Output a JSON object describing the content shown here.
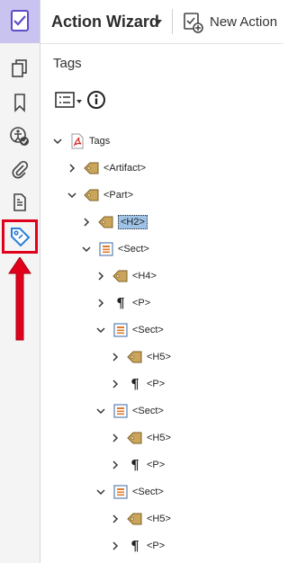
{
  "header": {
    "title": "Action Wizard",
    "new_action": "New Action"
  },
  "panel": {
    "title": "Tags"
  },
  "toolbar": {
    "items": [
      "tools-icon",
      "pages-icon",
      "bookmarks-icon",
      "accessibility-icon",
      "attachments-icon",
      "content-icon",
      "tags-icon"
    ],
    "active": "tags-icon"
  },
  "annotation": {
    "arrow_color": "#e0001b",
    "highlight_color": "#e0001b"
  },
  "tree": [
    {
      "label": "Tags",
      "level": 0,
      "icon": "pdf-icon",
      "expanded": true
    },
    {
      "label": "<Artifact>",
      "level": 1,
      "icon": "tag-icon",
      "expanded": false
    },
    {
      "label": "<Part>",
      "level": 1,
      "icon": "tag-icon",
      "expanded": true
    },
    {
      "label": "<H2>",
      "level": 2,
      "icon": "tag-icon",
      "expanded": false,
      "selected": true
    },
    {
      "label": "<Sect>",
      "level": 2,
      "icon": "sect-icon",
      "expanded": true
    },
    {
      "label": "<H4>",
      "level": 3,
      "icon": "tag-icon",
      "expanded": false
    },
    {
      "label": "<P>",
      "level": 3,
      "icon": "paragraph-icon",
      "expanded": false
    },
    {
      "label": "<Sect>",
      "level": 3,
      "icon": "sect-icon",
      "expanded": true
    },
    {
      "label": "<H5>",
      "level": 4,
      "icon": "tag-icon",
      "expanded": false
    },
    {
      "label": "<P>",
      "level": 4,
      "icon": "paragraph-icon",
      "expanded": false
    },
    {
      "label": "<Sect>",
      "level": 3,
      "icon": "sect-icon",
      "expanded": true
    },
    {
      "label": "<H5>",
      "level": 4,
      "icon": "tag-icon",
      "expanded": false
    },
    {
      "label": "<P>",
      "level": 4,
      "icon": "paragraph-icon",
      "expanded": false
    },
    {
      "label": "<Sect>",
      "level": 3,
      "icon": "sect-icon",
      "expanded": true
    },
    {
      "label": "<H5>",
      "level": 4,
      "icon": "tag-icon",
      "expanded": false
    },
    {
      "label": "<P>",
      "level": 4,
      "icon": "paragraph-icon",
      "expanded": false
    }
  ]
}
